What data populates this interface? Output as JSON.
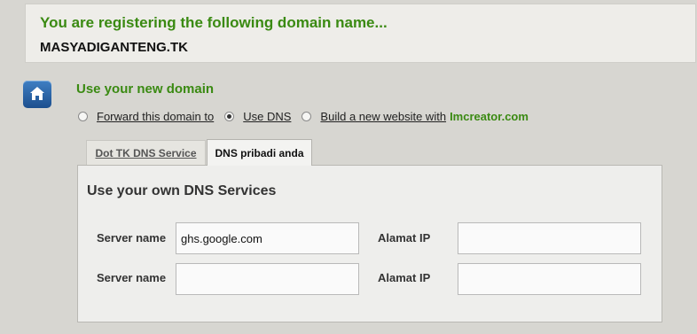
{
  "registration": {
    "title": "You are registering the following domain name...",
    "domain": "MASYADIGANTENG.TK"
  },
  "use_domain": {
    "title": "Use your new domain",
    "options": [
      {
        "label": "Forward this domain to",
        "checked": false
      },
      {
        "label": "Use DNS",
        "checked": true
      },
      {
        "label": "Build a new website with",
        "checked": false
      }
    ],
    "brand": "Imcreator.com"
  },
  "tabs": [
    {
      "label": "Dot TK DNS Service",
      "active": false
    },
    {
      "label": "DNS pribadi anda",
      "active": true
    }
  ],
  "dns_panel": {
    "title": "Use your own DNS Services",
    "rows": [
      {
        "server_label": "Server name",
        "server_value": "ghs.google.com",
        "ip_label": "Alamat IP",
        "ip_value": ""
      },
      {
        "server_label": "Server name",
        "server_value": "",
        "ip_label": "Alamat IP",
        "ip_value": ""
      }
    ]
  },
  "colors": {
    "accent_green": "#3a8a12",
    "home_icon_blue": "#2a64a8"
  },
  "icons": {
    "home": "home-icon"
  }
}
